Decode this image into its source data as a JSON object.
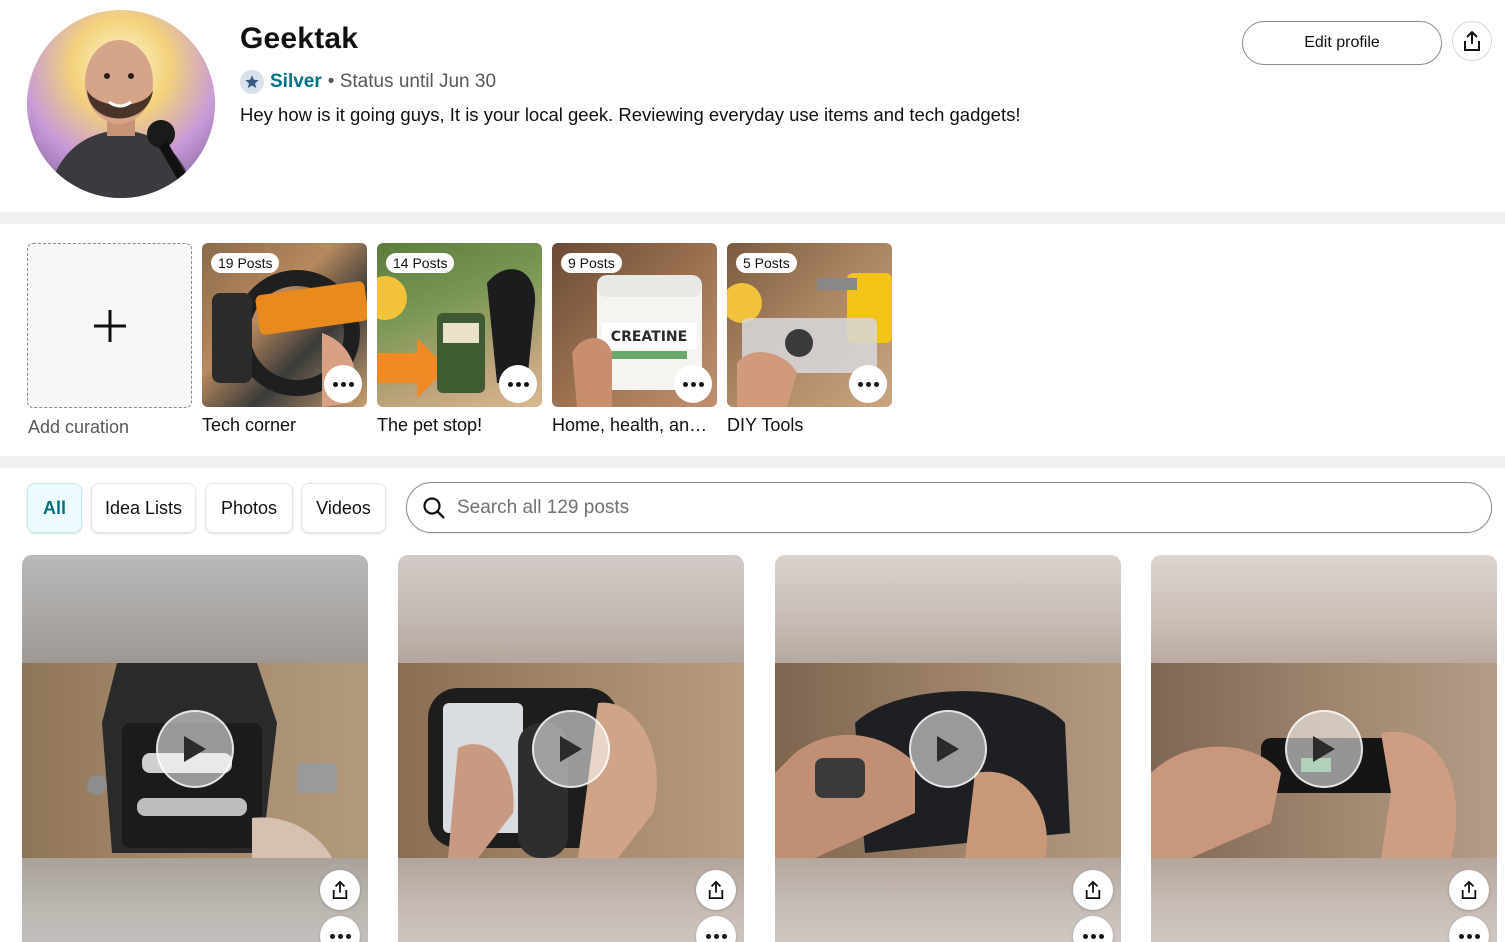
{
  "profile": {
    "name": "Geektak",
    "tier": "Silver",
    "status": "• Status until Jun 30",
    "bio": "Hey how is it going guys, It is your local geek. Reviewing everyday use items and tech gadgets!",
    "edit_label": "Edit profile",
    "share_icon": "share-icon"
  },
  "curations": {
    "add_label": "Add curation",
    "items": [
      {
        "count": "19 Posts",
        "label": "Tech corner"
      },
      {
        "count": "14 Posts",
        "label": "The pet stop!"
      },
      {
        "count": "9 Posts",
        "label": "Home, health, and…"
      },
      {
        "count": "5 Posts",
        "label": "DIY Tools"
      }
    ]
  },
  "filters": {
    "tabs": [
      {
        "label": "All",
        "active": true
      },
      {
        "label": "Idea Lists",
        "active": false
      },
      {
        "label": "Photos",
        "active": false
      },
      {
        "label": "Videos",
        "active": false
      }
    ],
    "search_placeholder": "Search all 129 posts"
  },
  "colors": {
    "accent": "#007185",
    "text": "#0f1111",
    "muted": "#565959"
  }
}
